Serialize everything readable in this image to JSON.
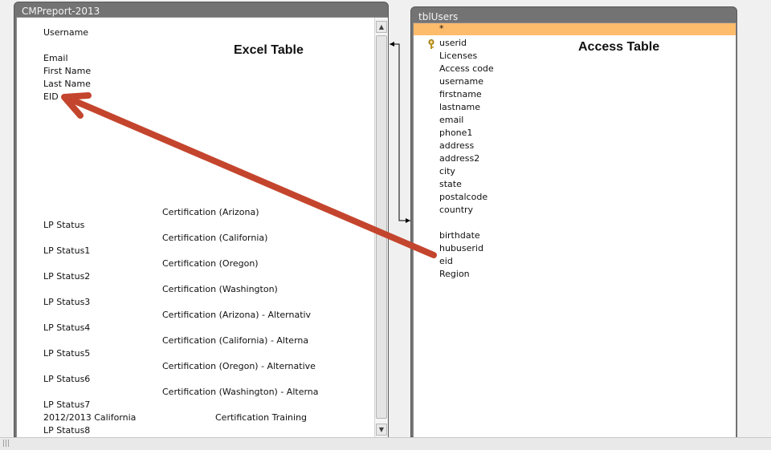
{
  "excel_window": {
    "title": "CMPreport-2013",
    "label": "Excel Table",
    "fields": [
      "Username",
      "Email",
      "First Name",
      "Last Name",
      "EID",
      "Certification (Arizona)",
      "LP Status",
      "Certification (California)",
      "LP Status1",
      "Certification (Oregon)",
      "LP Status2",
      "Certification (Washington)",
      "LP Status3",
      "Certification (Arizona) - Alternativ",
      "LP Status4",
      "Certification (California) - Alterna",
      "LP Status5",
      "Certification (Oregon) - Alternative",
      "LP Status6",
      "Certification (Washington) - Alterna",
      "LP Status7",
      "2012/2013 California",
      "Certification Training",
      "LP Status8"
    ]
  },
  "access_window": {
    "title": "tblUsers",
    "label": "Access Table",
    "selected_row": "*",
    "key_icon": "key-icon",
    "fields": [
      "userid",
      "Licenses",
      "Access code",
      "username",
      "firstname",
      "lastname",
      "email",
      "phone1",
      "address",
      "address2",
      "city",
      "state",
      "postalcode",
      "country",
      "birthdate",
      "hubuserid",
      "eid",
      "Region"
    ]
  },
  "colors": {
    "selected_row": "#fdbb6c",
    "arrow": "#c4452d"
  }
}
